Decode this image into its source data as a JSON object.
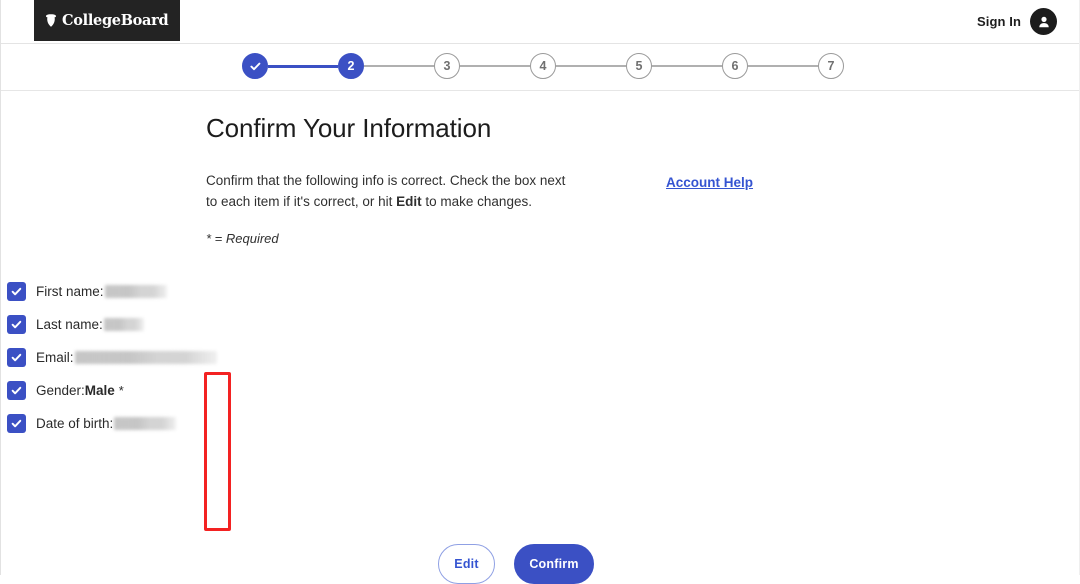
{
  "header": {
    "logo_text": "CollegeBoard",
    "logo_icon": "acorn-icon",
    "signin_label": "Sign In",
    "avatar_icon": "person-avatar-icon"
  },
  "stepper": {
    "steps": [
      {
        "label": "",
        "state": "done",
        "icon": "check-icon"
      },
      {
        "label": "2",
        "state": "current"
      },
      {
        "label": "3",
        "state": "todo"
      },
      {
        "label": "4",
        "state": "todo"
      },
      {
        "label": "5",
        "state": "todo"
      },
      {
        "label": "6",
        "state": "todo"
      },
      {
        "label": "7",
        "state": "todo"
      }
    ],
    "active_color": "#3b50c4",
    "inactive_color": "#b0b0b0"
  },
  "main": {
    "title": "Confirm Your Information",
    "intro_prefix": "Confirm that the following info is correct. Check the box next to each item if it's correct, or hit ",
    "intro_bold": "Edit",
    "intro_suffix": " to make changes.",
    "required_note": "* = Required",
    "account_help_link": "Account Help"
  },
  "checklist": {
    "items": [
      {
        "label": "First name:",
        "value": "",
        "redacted": true,
        "redacted_width": 62,
        "checked": true,
        "required": false
      },
      {
        "label": "Last name:",
        "value": "",
        "redacted": true,
        "redacted_width": 40,
        "checked": true,
        "required": false
      },
      {
        "label": "Email:",
        "value": "",
        "redacted": true,
        "redacted_width": 142,
        "checked": true,
        "required": false
      },
      {
        "label": "Gender:",
        "value": "Male",
        "redacted": false,
        "redacted_width": 0,
        "checked": true,
        "required": true
      },
      {
        "label": "Date of birth:",
        "value": "",
        "redacted": true,
        "redacted_width": 62,
        "checked": true,
        "required": false
      }
    ]
  },
  "annotation": {
    "highlight_color": "#f32222"
  },
  "buttons": {
    "edit_label": "Edit",
    "confirm_label": "Confirm",
    "primary_color": "#3b50c4"
  }
}
